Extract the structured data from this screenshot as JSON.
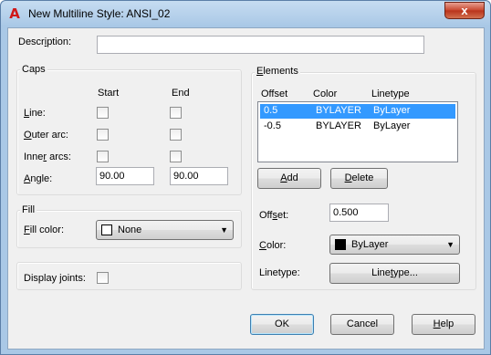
{
  "window": {
    "title": "New Multiline Style: ANSI_02",
    "close_glyph": "x"
  },
  "description": {
    "label_pre": "Descr",
    "label_u": "i",
    "label_post": "ption:",
    "value": ""
  },
  "caps": {
    "title": "Caps",
    "start_header": "Start",
    "end_header": "End",
    "line": {
      "u": "L",
      "rest": "ine:"
    },
    "outer_arc": {
      "u": "O",
      "rest": "uter arc:"
    },
    "inner_arcs": {
      "pre": "Inne",
      "u": "r",
      "rest": " arcs:"
    },
    "angle": {
      "u": "A",
      "rest": "ngle:"
    },
    "angle_start": "90.00",
    "angle_end": "90.00"
  },
  "fill": {
    "title": "Fill",
    "label": {
      "u": "F",
      "rest": "ill color:"
    },
    "value": "None",
    "swatch_color": "#ffffff"
  },
  "display_joints": {
    "pre": "Display ",
    "u": "j",
    "rest": "oints:"
  },
  "elements": {
    "title": {
      "u": "E",
      "rest": "lements"
    },
    "headers": {
      "offset": "Offset",
      "color": "Color",
      "linetype": "Linetype"
    },
    "rows": [
      {
        "offset": "0.5",
        "color": "BYLAYER",
        "linetype": "ByLayer",
        "selected": true
      },
      {
        "offset": "-0.5",
        "color": "BYLAYER",
        "linetype": "ByLayer",
        "selected": false
      }
    ],
    "add": {
      "u": "A",
      "rest": "dd"
    },
    "delete": {
      "u": "D",
      "rest": "elete"
    },
    "offset_label": {
      "pre": "Off",
      "u": "s",
      "rest": "et:"
    },
    "offset_value": "0.500",
    "color_label": {
      "u": "C",
      "rest": "olor:"
    },
    "color_value": "ByLayer",
    "color_swatch": "#000000",
    "linetype_label": "Linetype:",
    "linetype_button": {
      "pre": "Line",
      "u": "t",
      "rest": "ype..."
    }
  },
  "buttons": {
    "ok": "OK",
    "cancel": "Cancel",
    "help": {
      "u": "H",
      "rest": "elp"
    }
  },
  "colors": {
    "selection": "#3399ff",
    "title_bar": "#a9c8e6",
    "dialog_bg": "#f0f0f0"
  }
}
